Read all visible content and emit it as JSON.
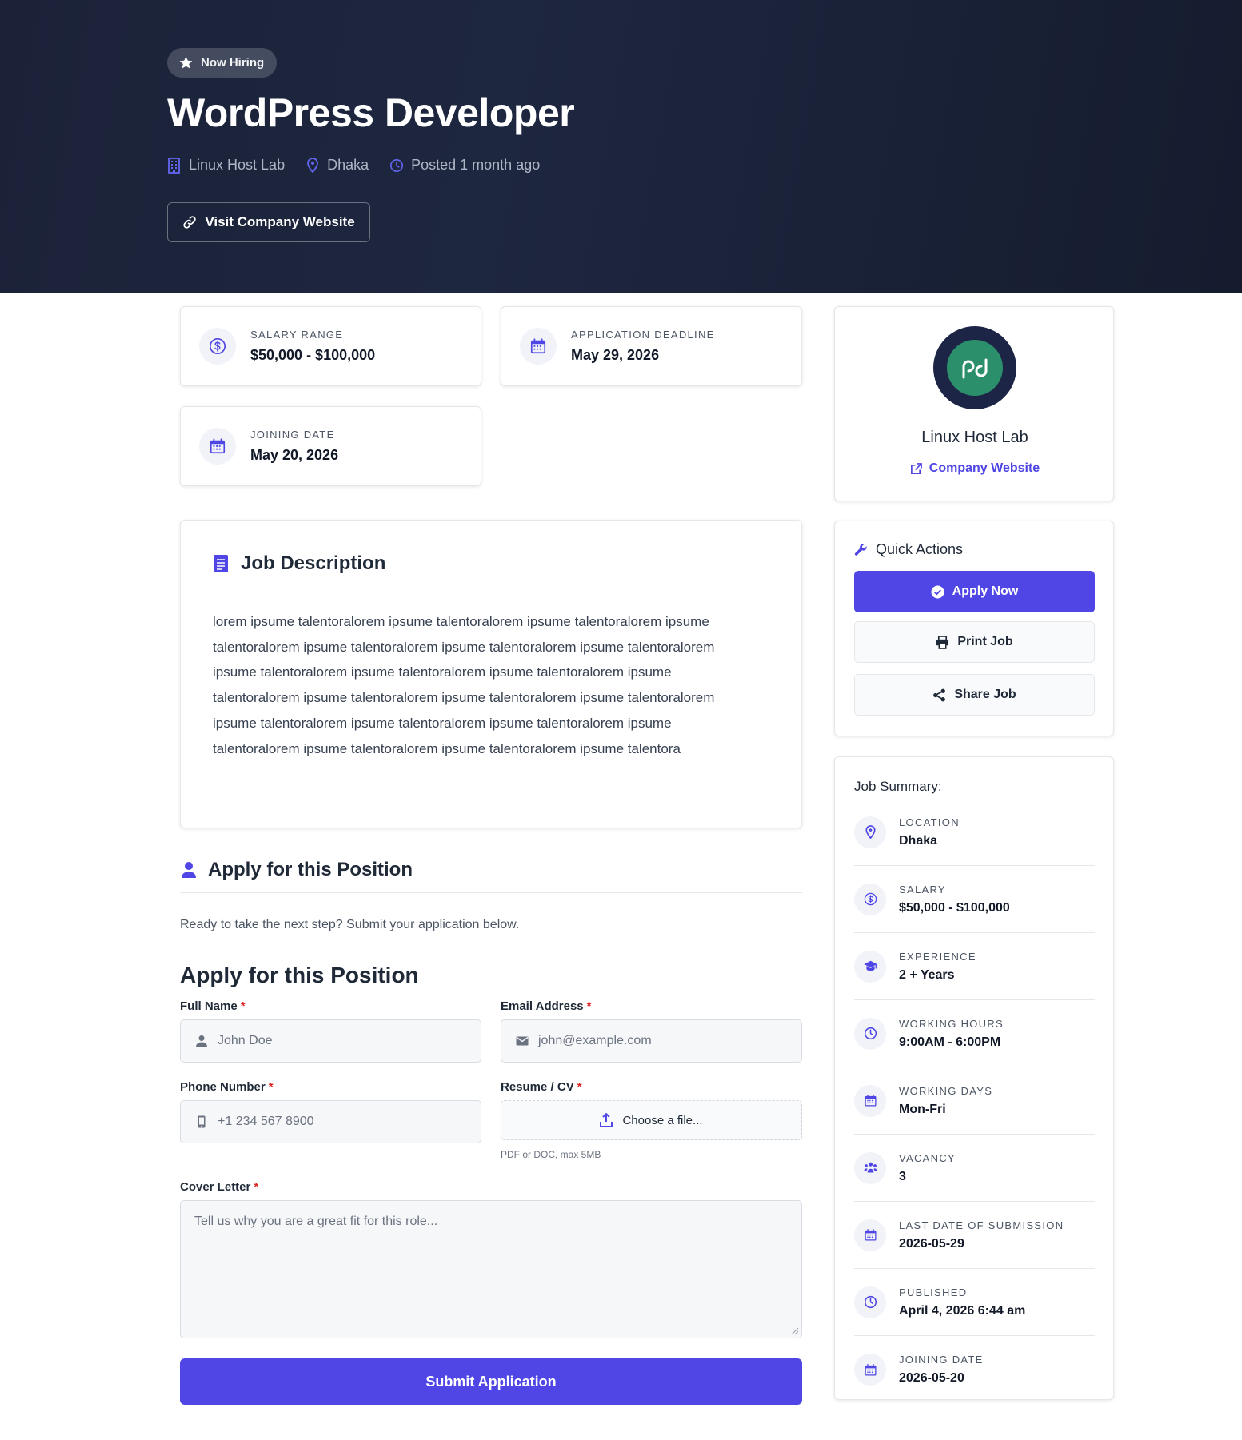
{
  "hero": {
    "badge": "Now Hiring",
    "title": "WordPress Developer",
    "company": "Linux Host Lab",
    "location": "Dhaka",
    "posted": "Posted 1 month ago",
    "visit_button": "Visit Company Website"
  },
  "stats": [
    {
      "label": "SALARY RANGE",
      "value": "$50,000 - $100,000",
      "icon": "dollar-icon"
    },
    {
      "label": "APPLICATION DEADLINE",
      "value": "May 29, 2026",
      "icon": "calendar-icon"
    },
    {
      "label": "JOINING DATE",
      "value": "May 20, 2026",
      "icon": "calendar-icon"
    }
  ],
  "description": {
    "title": "Job Description",
    "body": "lorem ipsume talentoralorem ipsume talentoralorem ipsume talentoralorem ipsume talentoralorem ipsume talentoralorem ipsume talentoralorem ipsume talentoralorem ipsume talentoralorem ipsume talentoralorem ipsume talentoralorem ipsume talentoralorem ipsume talentoralorem ipsume talentoralorem ipsume talentoralorem ipsume talentoralorem ipsume talentoralorem ipsume talentoralorem ipsume talentoralorem ipsume talentoralorem ipsume talentoralorem ipsume talentora"
  },
  "apply": {
    "heading": "Apply for this Position",
    "intro": "Ready to take the next step? Submit your application below.",
    "form_title": "Apply for this Position",
    "required_mark": "*",
    "full_name": {
      "label": "Full Name",
      "placeholder": "John Doe"
    },
    "email": {
      "label": "Email Address",
      "placeholder": "john@example.com"
    },
    "phone": {
      "label": "Phone Number",
      "placeholder": "+1 234 567 8900"
    },
    "resume": {
      "label": "Resume / CV",
      "button": "Choose a file...",
      "hint": "PDF or DOC, max 5MB"
    },
    "cover_letter": {
      "label": "Cover Letter",
      "placeholder": "Tell us why you are a great fit for this role..."
    },
    "submit": "Submit Application"
  },
  "company_card": {
    "name": "Linux Host Lab",
    "link": "Company Website"
  },
  "quick_actions": {
    "title": "Quick Actions",
    "apply": "Apply Now",
    "print": "Print Job",
    "share": "Share Job"
  },
  "summary": {
    "title": "Job Summary:",
    "rows": [
      {
        "label": "LOCATION",
        "value": "Dhaka",
        "icon": "location-pin-icon"
      },
      {
        "label": "SALARY",
        "value": "$50,000 - $100,000",
        "icon": "dollar-icon"
      },
      {
        "label": "EXPERIENCE",
        "value": "2 + Years",
        "icon": "graduation-cap-icon"
      },
      {
        "label": "WORKING HOURS",
        "value": "9:00AM - 6:00PM",
        "icon": "clock-icon"
      },
      {
        "label": "WORKING DAYS",
        "value": "Mon-Fri",
        "icon": "calendar-icon"
      },
      {
        "label": "VACANCY",
        "value": "3",
        "icon": "users-icon"
      },
      {
        "label": "LAST DATE OF SUBMISSION",
        "value": "2026-05-29",
        "icon": "calendar-icon"
      },
      {
        "label": "PUBLISHED",
        "value": "April 4, 2026 6:44 am",
        "icon": "clock-icon"
      },
      {
        "label": "JOINING DATE",
        "value": "2026-05-20",
        "icon": "calendar-icon"
      }
    ]
  },
  "colors": {
    "accent": "#4f46e5",
    "hero_bg": "#1b2238",
    "logo_bg": "#1d2547",
    "logo_inner": "#2a8f6a",
    "required": "#dc2626"
  }
}
